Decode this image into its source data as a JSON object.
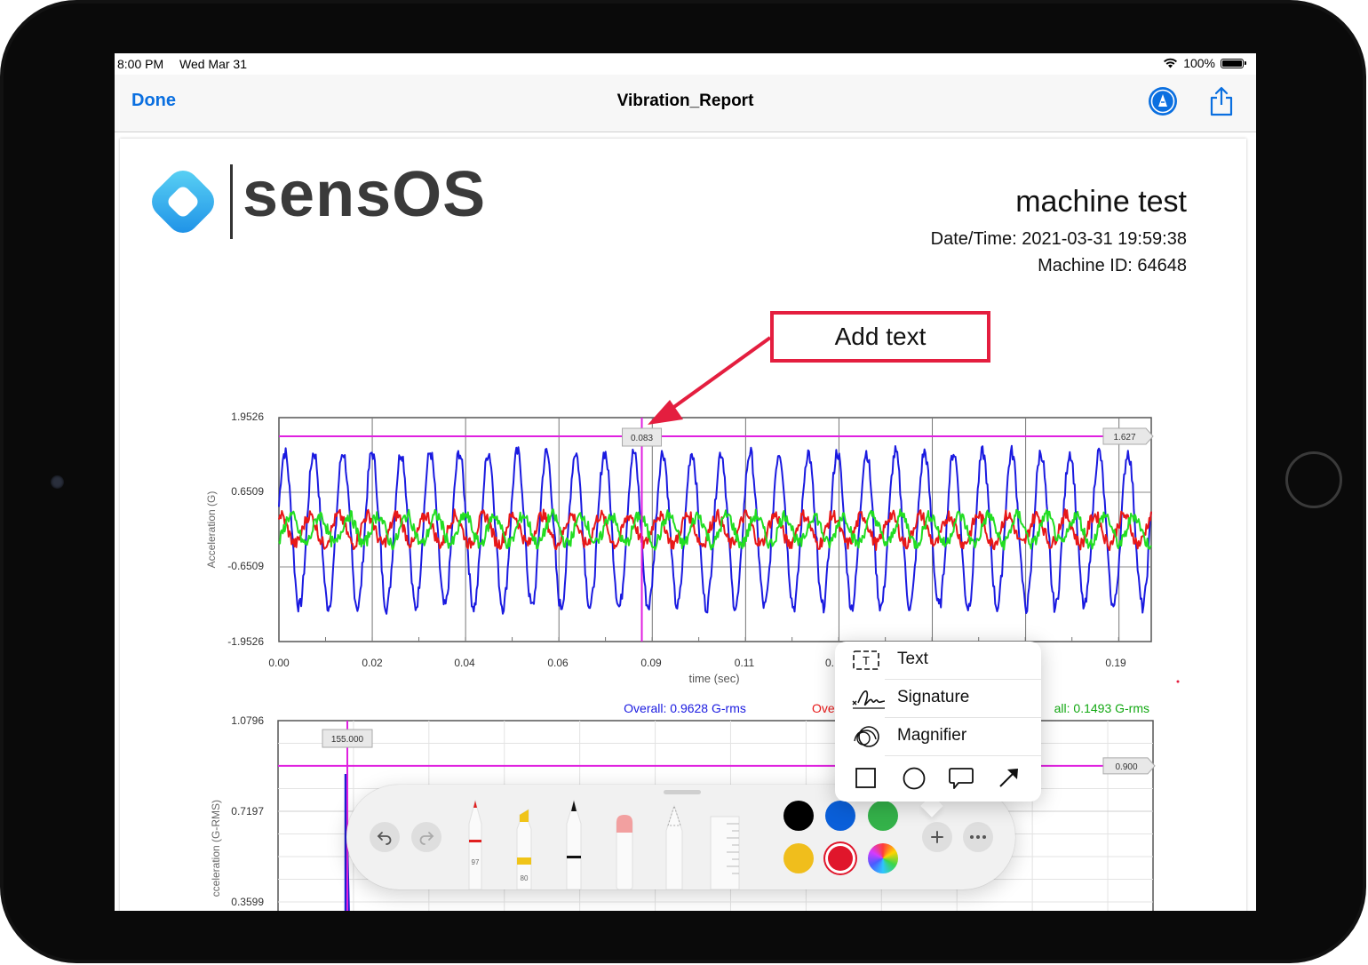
{
  "status_bar": {
    "time": "8:00 PM",
    "date": "Wed Mar 31",
    "battery": "100%"
  },
  "nav": {
    "done": "Done",
    "title": "Vibration_Report"
  },
  "report": {
    "logo_text": "sensOS",
    "title": "machine test",
    "datetime": "Date/Time: 2021-03-31 19:59:38",
    "machine_id": "Machine ID: 64648"
  },
  "annotation": {
    "text": "Add text",
    "color": "#e41e3f"
  },
  "chart_data": [
    {
      "type": "line",
      "xlabel": "time (sec)",
      "ylabel": "Acceleration (G)",
      "ylim": [
        -1.9526,
        1.9526
      ],
      "xlim": [
        0.0,
        0.1875
      ],
      "y_ticks": [
        "1.9526",
        "0.6509",
        "-0.6509",
        "-1.9526"
      ],
      "x_ticks": [
        "0.00",
        "0.02",
        "0.04",
        "0.06",
        "0.09",
        "0.11",
        "0.",
        "0.19"
      ],
      "cursor": {
        "x_label": "0.083",
        "y_label": "1.627",
        "x": 0.078,
        "y": 1.627,
        "color": "#e020e0"
      },
      "series": [
        {
          "color": "#1a1ae0",
          "amplitude": 1.35,
          "cycles": 30
        },
        {
          "color": "#e81818",
          "amplitude": 0.25,
          "cycles": 30
        },
        {
          "color": "#22dd22",
          "amplitude": 0.25,
          "cycles": 30
        }
      ],
      "legend": [
        {
          "text": "Overall: 0.9628 G-rms",
          "color": "#1a1ae0"
        },
        {
          "text": "Ove",
          "color": "#e81818"
        },
        {
          "text": "all: 0.1493 G-rms",
          "color": "#12a812"
        }
      ]
    },
    {
      "type": "line",
      "ylabel": "cceleration (G-RMS)",
      "ylim": [
        0.3599,
        1.0796
      ],
      "y_ticks": [
        "1.0796",
        "0.7197",
        "0.3599"
      ],
      "cursor": {
        "x_label": "155.000",
        "y_label": "0.900",
        "y": 0.9,
        "color": "#e020e0"
      },
      "series": [
        {
          "color": "#2020d0"
        }
      ]
    }
  ],
  "markup_toolbar": {
    "tools": [
      {
        "name": "pen",
        "label": "97",
        "tip_color": "#e02020"
      },
      {
        "name": "marker",
        "label": "80",
        "tip_color": "#f0c419"
      },
      {
        "name": "pencil",
        "label": "",
        "tip_color": "#111111"
      },
      {
        "name": "eraser",
        "label": "",
        "tip_color": "#f2a0a0"
      },
      {
        "name": "lasso",
        "label": "",
        "tip_color": "#bbbbbb"
      },
      {
        "name": "ruler",
        "label": "",
        "tip_color": "#dddddd"
      }
    ],
    "colors": [
      "#000000",
      "#0a5fd9",
      "#34b24a",
      "#f0be1c",
      "#e0162b"
    ],
    "selected_color": "#e0162b"
  },
  "add_menu": {
    "items": [
      {
        "label": "Text"
      },
      {
        "label": "Signature"
      },
      {
        "label": "Magnifier"
      }
    ],
    "shapes": [
      "square",
      "circle",
      "speech-bubble",
      "arrow"
    ]
  }
}
